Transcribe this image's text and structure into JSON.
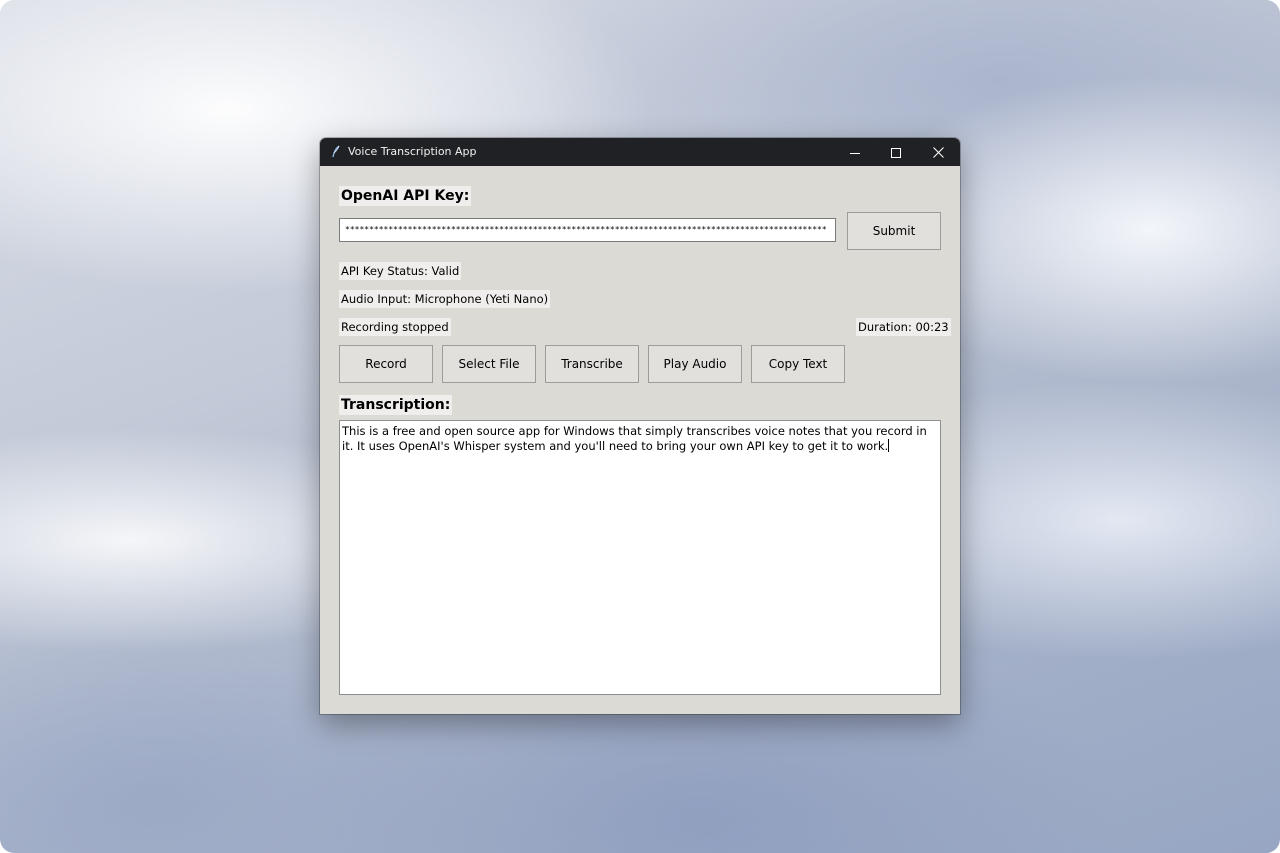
{
  "window": {
    "title": "Voice Transcription App"
  },
  "api_key": {
    "label": "OpenAI API Key:",
    "value": "****************************************************************************************************",
    "submit_label": "Submit"
  },
  "status": {
    "api_key_status": "API Key Status: Valid",
    "audio_input": "Audio Input: Microphone (Yeti Nano)",
    "recording": "Recording stopped",
    "duration": "Duration: 00:23"
  },
  "actions": {
    "record": "Record",
    "select_file": "Select File",
    "transcribe": "Transcribe",
    "play_audio": "Play Audio",
    "copy_text": "Copy Text"
  },
  "transcription": {
    "label": "Transcription:",
    "text": "This is a free and open source app for Windows that simply transcribes voice notes that you record in it. It uses OpenAI's Whisper system and you'll need to bring your own API key to get it to work."
  },
  "icons": {
    "app": "feather-icon",
    "minimize": "minimize-icon",
    "maximize": "maximize-icon",
    "close": "close-icon"
  },
  "colors": {
    "titlebar": "#202124",
    "window_bg": "#dcdad5",
    "button_bg": "#e1e0dd"
  }
}
